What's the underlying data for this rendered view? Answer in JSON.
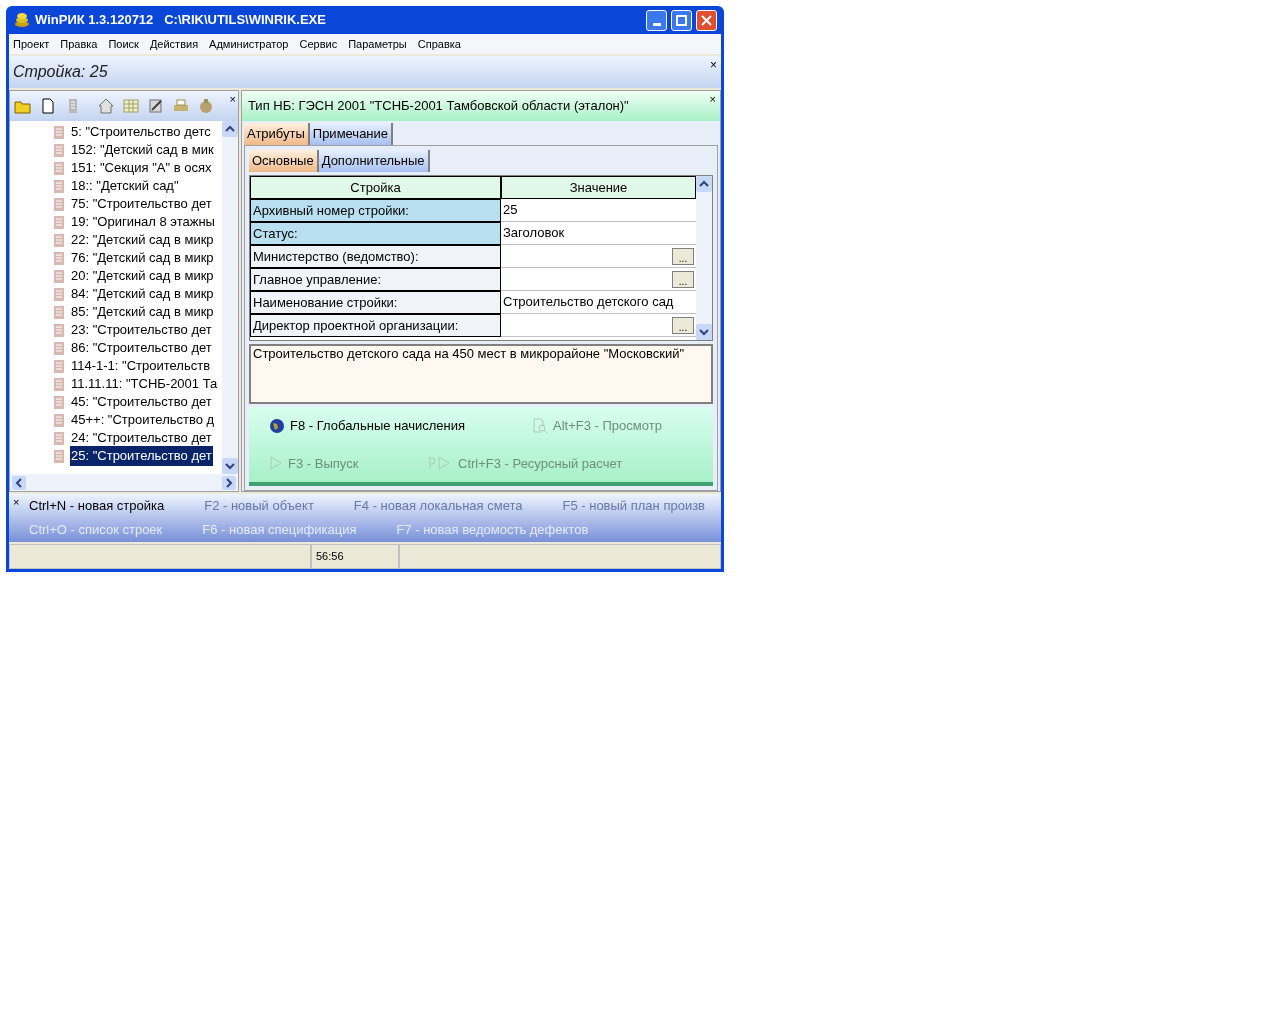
{
  "window": {
    "title": "WinРИК 1.3.120712   C:\\RIK\\UTILS\\WINRIK.EXE"
  },
  "menu": [
    "Проект",
    "Правка",
    "Поиск",
    "Действия",
    "Администратор",
    "Сервис",
    "Параметры",
    "Справка"
  ],
  "document_bar": {
    "title": "Стройка: 25",
    "close": "×"
  },
  "toolbar": [
    {
      "kind": "folder",
      "disabled": false
    },
    {
      "kind": "new",
      "disabled": false
    },
    {
      "kind": "building",
      "disabled": true
    },
    {
      "kind": "home",
      "disabled": false
    },
    {
      "kind": "table",
      "disabled": false
    },
    {
      "kind": "edit",
      "disabled": false
    },
    {
      "kind": "print",
      "disabled": false
    },
    {
      "kind": "bag",
      "disabled": false
    }
  ],
  "panel_close": "×",
  "tree": [
    {
      "label": "5: \"Строительство детс",
      "selected": false
    },
    {
      "label": "152: \"Детский сад в мик",
      "selected": false
    },
    {
      "label": "151: \"Секция \"А\" в осях",
      "selected": false
    },
    {
      "label": "18:: \"Детский сад\"",
      "selected": false
    },
    {
      "label": "75: \"Строительство дет",
      "selected": false
    },
    {
      "label": "19: \"Оригинал 8 этажны",
      "selected": false
    },
    {
      "label": "22: \"Детский сад в микр",
      "selected": false
    },
    {
      "label": "76: \"Детский сад в микр",
      "selected": false
    },
    {
      "label": "20: \"Детский сад в микр",
      "selected": false
    },
    {
      "label": "84: \"Детский сад в микр",
      "selected": false
    },
    {
      "label": "85: \"Детский сад в микр",
      "selected": false
    },
    {
      "label": "23: \"Строительство дет",
      "selected": false
    },
    {
      "label": "86: \"Строительство дет",
      "selected": false
    },
    {
      "label": "114-1-1: \"Строительств",
      "selected": false
    },
    {
      "label": "11.11.11: \"ТСНБ-2001 Та",
      "selected": false
    },
    {
      "label": "45: \"Строительство дет",
      "selected": false
    },
    {
      "label": "45++: \"Строительство д",
      "selected": false
    },
    {
      "label": "24: \"Строительство дет",
      "selected": false
    },
    {
      "label": "25: \"Строительство дет",
      "selected": true
    }
  ],
  "details": {
    "header": "Тип НБ: ГЭСН 2001 \"ТСНБ-2001 Тамбовской области (эталон)\"",
    "close": "×",
    "tabs": [
      {
        "label": "Атрибуты",
        "selected": true
      },
      {
        "label": "Примечание",
        "selected": false
      }
    ],
    "subtabs": [
      {
        "label": "Основные",
        "selected": true
      },
      {
        "label": "Дополнительные",
        "selected": false
      }
    ],
    "table": {
      "columns": [
        "Стройка",
        "Значение"
      ],
      "rows": [
        {
          "label": "Архивный номер стройки:",
          "value": "25",
          "kind": "text",
          "highlighted": true
        },
        {
          "label": "Статус:",
          "value": "Заголовок",
          "kind": "text",
          "highlighted": true
        },
        {
          "label": "Министерство (ведомство):",
          "kind": "picker",
          "button": "...",
          "highlighted": false
        },
        {
          "label": "Главное управление:",
          "kind": "picker",
          "button": "...",
          "highlighted": false
        },
        {
          "label": "Наименование стройки:",
          "value": "Строительство детского сад",
          "kind": "text",
          "highlighted": false
        },
        {
          "label": "Директор проектной организации:",
          "kind": "picker",
          "button": "...",
          "highlighted": false
        }
      ]
    },
    "memo": "Строительство детского сада на 450 мест в микрорайоне \"Московский\"",
    "actions": [
      [
        {
          "label": "F8 - Глобальные начисления",
          "kind": "globe",
          "disabled": false
        },
        {
          "label": "Alt+F3 - Просмотр",
          "kind": "preview",
          "disabled": true
        }
      ],
      [
        {
          "label": "F3 - Выпуск",
          "kind": "play",
          "disabled": true
        },
        {
          "label": "Ctrl+F3 - Ресурсный расчет",
          "kind": "rplay",
          "disabled": true
        }
      ]
    ]
  },
  "quick_bar": {
    "close": "×",
    "rows": [
      [
        {
          "label": "Ctrl+N - новая стройка",
          "disabled": false
        },
        {
          "label": "F2 - новый объект",
          "disabled": true
        },
        {
          "label": "F4 - новая локальная смета",
          "disabled": true
        },
        {
          "label": "F5 - новый план произв",
          "disabled": true
        }
      ],
      [
        {
          "label": "Ctrl+O - список строек",
          "disabled": true
        },
        {
          "label": "F6 - новая спецификация",
          "disabled": true
        },
        {
          "label": "F7 - новая ведомость дефектов",
          "disabled": true
        }
      ]
    ]
  },
  "status_bar": {
    "time": "56:56"
  }
}
